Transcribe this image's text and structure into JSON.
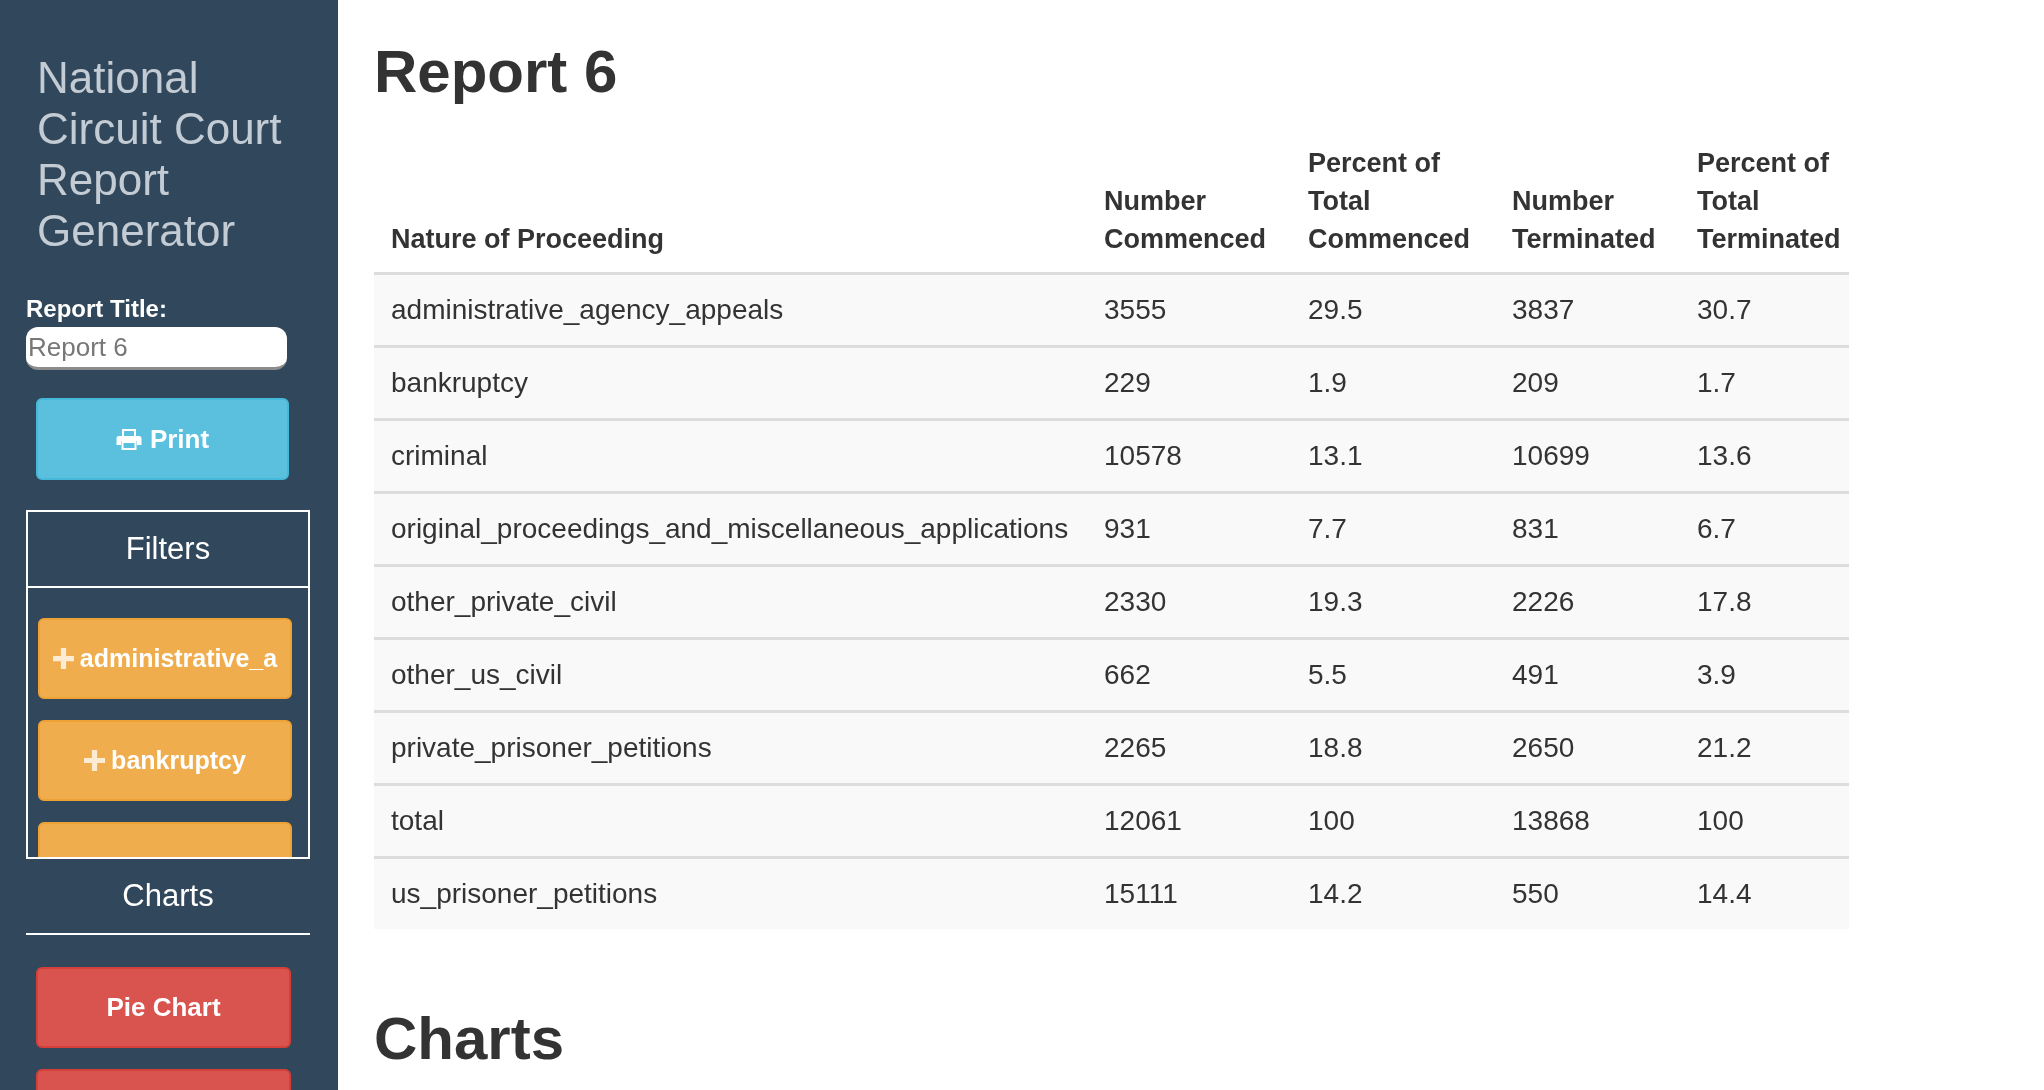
{
  "sidebar": {
    "app_title": "National Circuit Court Report Generator",
    "report_title_field": {
      "label": "Report Title:",
      "value": "Report 6"
    },
    "print_button": {
      "label": "Print"
    },
    "filters": {
      "heading": "Filters",
      "buttons": [
        "administrative_a",
        "bankruptcy"
      ],
      "more_button_cut_off": true
    },
    "charts": {
      "heading": "Charts",
      "buttons": [
        "Pie Chart"
      ],
      "more_button_cut_off": true
    }
  },
  "report": {
    "title": "Report 6",
    "table": {
      "columns": [
        "Nature of Proceeding",
        "Number Commenced",
        "Percent of Total Commenced",
        "Number Terminated",
        "Percent of Total Terminated"
      ],
      "rows": [
        [
          "administrative_agency_appeals",
          "3555",
          "29.5",
          "3837",
          "30.7"
        ],
        [
          "bankruptcy",
          "229",
          "1.9",
          "209",
          "1.7"
        ],
        [
          "criminal",
          "10578",
          "13.1",
          "10699",
          "13.6"
        ],
        [
          "original_proceedings_and_miscellaneous_applications",
          "931",
          "7.7",
          "831",
          "6.7"
        ],
        [
          "other_private_civil",
          "2330",
          "19.3",
          "2226",
          "17.8"
        ],
        [
          "other_us_civil",
          "662",
          "5.5",
          "491",
          "3.9"
        ],
        [
          "private_prisoner_petitions",
          "2265",
          "18.8",
          "2650",
          "21.2"
        ],
        [
          "total",
          "12061",
          "100",
          "13868",
          "100"
        ],
        [
          "us_prisoner_petitions",
          "15111",
          "14.2",
          "550",
          "14.4"
        ]
      ]
    },
    "charts_heading": "Charts"
  }
}
